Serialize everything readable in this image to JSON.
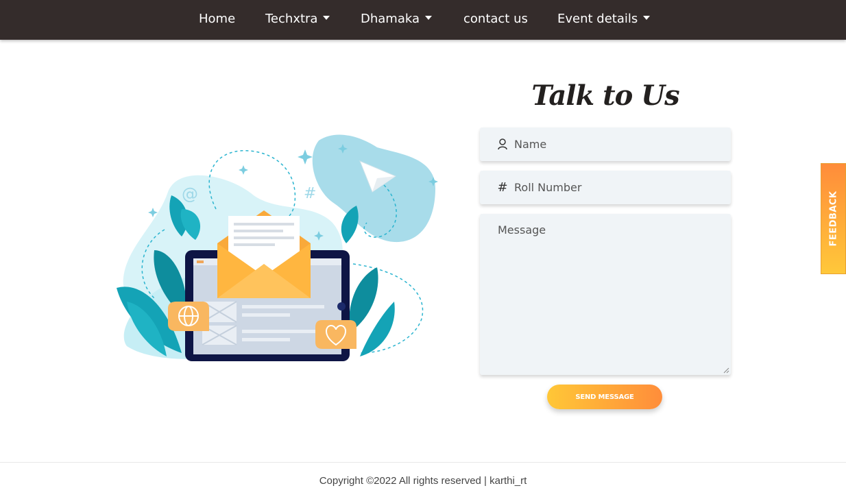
{
  "nav": {
    "items": [
      {
        "label": "Home",
        "dropdown": false
      },
      {
        "label": "Techxtra",
        "dropdown": true
      },
      {
        "label": "Dhamaka",
        "dropdown": true
      },
      {
        "label": "contact us",
        "dropdown": false
      },
      {
        "label": "Event details",
        "dropdown": true
      }
    ]
  },
  "contact": {
    "title": "Talk to Us",
    "name_placeholder": "Name",
    "roll_placeholder": "Roll Number",
    "message_placeholder": "Message",
    "send_label": "SEND MESSAGE"
  },
  "feedback": {
    "label": "FEEDBACK"
  },
  "footer": {
    "copyright": "Copyright ©2022 All rights reserved | karthi_rt"
  },
  "colors": {
    "navbar": "#342c2b",
    "accent_start": "#ffc737",
    "accent_end": "#ff8d3a",
    "field_bg": "#f0f4f7"
  }
}
